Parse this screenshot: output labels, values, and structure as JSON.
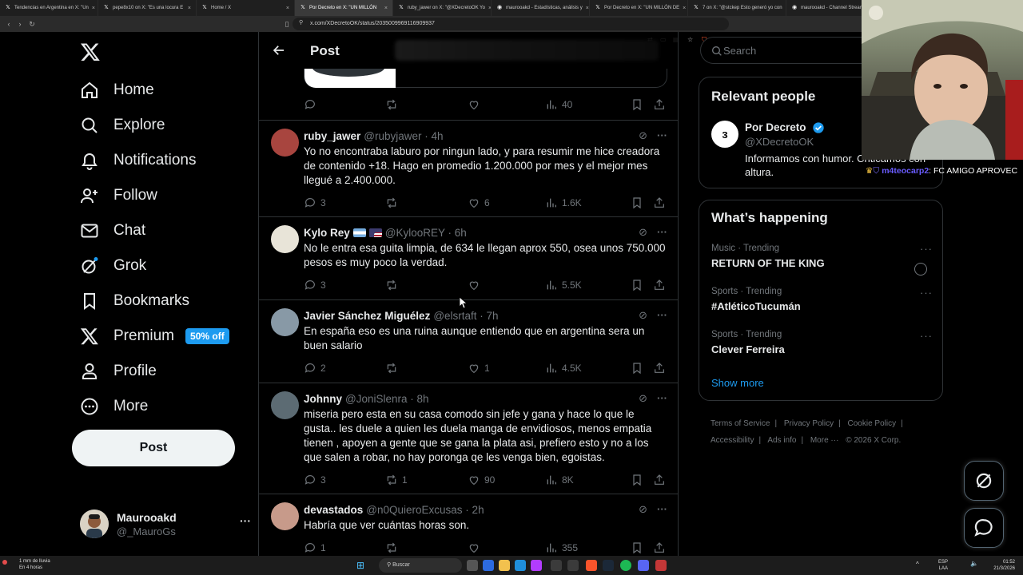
{
  "browser": {
    "tabs": [
      {
        "label": "Tendencias en Argentina en X: \"Un",
        "active": false
      },
      {
        "label": "pepe8x10 on X: \"Es una locura E",
        "active": false
      },
      {
        "label": "Home / X",
        "active": false
      },
      {
        "label": "Por Decreto en X: \"UN MILLÓN",
        "active": true
      },
      {
        "label": "ruby_jawer on X: \"@XDecretoOK Yo",
        "active": false
      },
      {
        "label": "maurooakd - Estadísticas, análisis y",
        "active": false
      },
      {
        "label": "Por Decreto en X: \"UN MILLÓN DE",
        "active": false
      },
      {
        "label": "7 on X: \"@stckep Esto generó yo con",
        "active": false
      },
      {
        "label": "maurooakd - Channel Stream",
        "active": false
      }
    ],
    "url": "x.com/XDecretoOK/status/2035009969116909937"
  },
  "nav": {
    "items": [
      {
        "label": "Home",
        "icon": "home-icon"
      },
      {
        "label": "Explore",
        "icon": "search-icon"
      },
      {
        "label": "Notifications",
        "icon": "bell-icon"
      },
      {
        "label": "Follow",
        "icon": "follow-icon"
      },
      {
        "label": "Chat",
        "icon": "mail-icon"
      },
      {
        "label": "Grok",
        "icon": "grok-icon"
      },
      {
        "label": "Bookmarks",
        "icon": "bookmark-icon"
      },
      {
        "label": "Premium",
        "icon": "x-logo-icon",
        "badge": "50% off"
      },
      {
        "label": "Profile",
        "icon": "person-icon"
      },
      {
        "label": "More",
        "icon": "more-circle-icon"
      }
    ],
    "post_button": "Post",
    "account": {
      "name": "Maurooakd",
      "handle": "@_MauroGs"
    }
  },
  "header": {
    "title": "Post"
  },
  "top_actions": {
    "replies": "",
    "retweets": "",
    "likes": "",
    "views": "40"
  },
  "tweets": [
    {
      "name": "ruby_jawer",
      "handle": "@rubyjawer · 4h",
      "text": "Yo no encontraba laburo por ningun lado, y para resumir me hice creadora de contenido +18. Hago en promedio 1.200.000 por mes y el mejor mes llegué a 2.400.000.",
      "replies": "3",
      "retweets": "",
      "likes": "6",
      "views": "1.6K",
      "avatar_color": "#a8453f"
    },
    {
      "name": "Kylo Rey",
      "handle": "@KylooREY · 6h",
      "text": "No le entra esa guita limpia, de 634 le llegan aprox 550, osea unos 750.000 pesos es muy poco la verdad.",
      "replies": "3",
      "retweets": "",
      "likes": "",
      "views": "5.5K",
      "avatar_color": "#e8e4d8"
    },
    {
      "name": "Javier Sánchez Miguélez",
      "handle": "@elsrtaft · 7h",
      "text": "En españa eso es una ruina aunque entiendo que en argentina sera un buen salario",
      "replies": "2",
      "retweets": "",
      "likes": "1",
      "views": "4.5K",
      "avatar_color": "#8899a6"
    },
    {
      "name": "Johnny",
      "handle": "@JoniSlenra · 8h",
      "text": "miseria pero esta en su casa comodo sin jefe y gana y hace lo que le gusta.. les duele a quien les duela manga de envidiosos, menos empatia tienen , apoyen a gente que se gana la plata asi, prefiero esto y no a los que salen a robar, no hay poronga qe les venga bien, egoistas.",
      "replies": "3",
      "retweets": "1",
      "likes": "90",
      "views": "8K",
      "avatar_color": "#5c6b73"
    },
    {
      "name": "devastados",
      "handle": "@n0QuieroExcusas · 2h",
      "text": "Habría que ver cuántas horas son.",
      "replies": "1",
      "retweets": "",
      "likes": "",
      "views": "355",
      "avatar_color": "#c79a8a"
    }
  ],
  "right": {
    "search_placeholder": "Search",
    "relevant_title": "Relevant people",
    "person": {
      "name": "Por Decreto",
      "handle": "@XDecretoOK",
      "bio": "Informamos con humor. Criticamos con altura."
    },
    "happening_title": "What’s happening",
    "trends": [
      {
        "meta": "Music · Trending",
        "title": "RETURN OF THE KING"
      },
      {
        "meta": "Sports · Trending",
        "title": "#AtléticoTucumán"
      },
      {
        "meta": "Sports · Trending",
        "title": "Clever Ferreira"
      }
    ],
    "show_more": "Show more",
    "footer": [
      "Terms of Service",
      "|",
      "Privacy Policy",
      "|",
      "Cookie Policy",
      "|",
      "Accessibility",
      "|",
      "Ads info",
      "|",
      "More ···",
      "© 2026 X Corp."
    ]
  },
  "stream_chat": {
    "user": "m4teocarp2",
    "message": ": FC AMIGO APROVEC"
  },
  "taskbar": {
    "weather": "1 mm de lluvia",
    "weather_sub": "En 4 horas",
    "search": "Buscar",
    "lang": "ESP",
    "lang_sub": "LAA",
    "time": "01:52",
    "date": "21/3/2026"
  },
  "colors": {
    "accent": "#1d9bf0",
    "border": "#2f3336",
    "muted": "#71767b",
    "text": "#e7e9ea"
  }
}
